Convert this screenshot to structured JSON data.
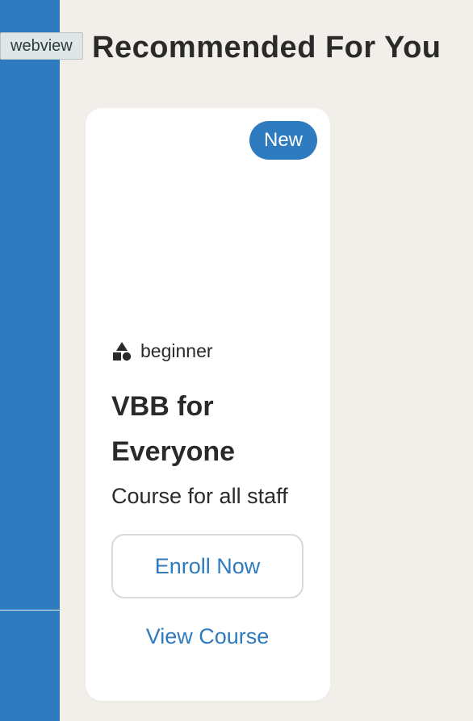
{
  "webview_tag": "webview",
  "section": {
    "title": "Recommended For You"
  },
  "card": {
    "badge": "New",
    "level_icon": "shapes-icon",
    "level": "beginner",
    "title": "VBB for Everyone",
    "description": "Course for all staff",
    "enroll_label": "Enroll Now",
    "view_label": "View Course"
  },
  "colors": {
    "accent": "#2f7bbf",
    "background": "#f2efea",
    "card": "#ffffff",
    "text": "#2a2a2a"
  }
}
